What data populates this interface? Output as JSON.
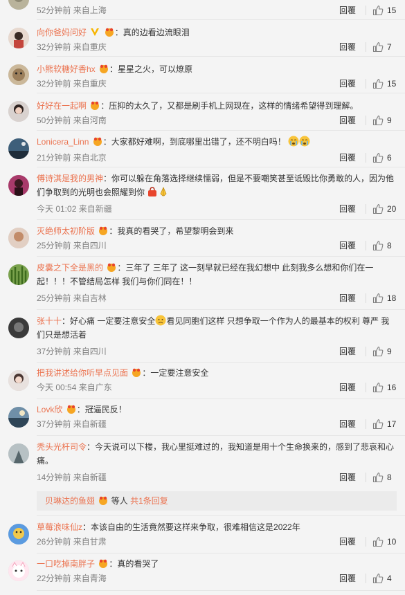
{
  "colors": {
    "username": "#eb7350",
    "meta": "#808080",
    "text": "#333333",
    "background": "#f4f4f4"
  },
  "reply_label": "回覆",
  "comments": [
    {
      "avatar": "avatar",
      "time": "52分钟前",
      "location": "来自上海",
      "likes": "15"
    },
    {
      "avatar": "avatar",
      "user": "向你爸妈问好",
      "text": "：真的边看边流眼泪",
      "time": "32分钟前",
      "location": "来自重庆",
      "likes": "7"
    },
    {
      "avatar": "avatar",
      "user": "小熊软糖好香hx",
      "text": "：星星之火，可以燎原",
      "time": "32分钟前",
      "location": "来自重庆",
      "likes": "15"
    },
    {
      "avatar": "avatar",
      "user": "好好在一起啊",
      "text": "：压抑的太久了，又都是刷手机上网现在，这样的情绪希望得到理解。",
      "time": "50分钟前",
      "location": "来自河南",
      "likes": "9"
    },
    {
      "avatar": "avatar",
      "user": "Lonicera_Linn",
      "text": "：大家都好难啊，到底哪里出错了，还不明白吗！",
      "time": "21分钟前",
      "location": "来自北京",
      "likes": "6"
    },
    {
      "avatar": "avatar",
      "user": "傅诗淇是我的男神",
      "text_line1": "：你可以躲在角落选择继续懦弱，但是不要嘲笑甚至诋毁比你勇敢的人，因为他",
      "text_line2": "们争取到的光明也会照耀到你",
      "time": "今天 01:02",
      "location": "来自新疆",
      "likes": "20"
    },
    {
      "avatar": "avatar",
      "user": "灭绝师太初阶版",
      "text": "：我真的看哭了，希望黎明会到来",
      "time": "25分钟前",
      "location": "来自四川",
      "likes": "8"
    },
    {
      "avatar": "avatar",
      "user": "皮囊之下全是黑的",
      "text_line1": "：三年了 三年了 这一刻早就已经在我幻想中 此刻我多么想和你们在一",
      "text_line2": "起！！！不管结局怎样 我们与你们同在！！",
      "time": "25分钟前",
      "location": "来自吉林",
      "likes": "18"
    },
    {
      "avatar": "avatar",
      "user": "张十十",
      "text_line1": "：好心痛 一定要注意安全",
      "text_line1b": "看见同胞们这样 只想争取一个作为人的最基本的权利 尊严 我",
      "text_line2": "们只是想活着",
      "time": "37分钟前",
      "location": "来自四川",
      "likes": "9"
    },
    {
      "avatar": "avatar",
      "user": "把我讲述给你听早点见面",
      "text": "：一定要注意安全",
      "time": "今天 00:54",
      "location": "来自广东",
      "likes": "16"
    },
    {
      "avatar": "avatar",
      "user": "Lovk欣",
      "text": "：冠逼民反！",
      "time": "37分钟前",
      "location": "来自新疆",
      "likes": "17"
    },
    {
      "avatar": "avatar",
      "user": "秃头光杆司令",
      "text_line1": "：今天说可以下楼，我心里挺难过的，我知道是用十个生命换来的，感到了悲哀和心",
      "text_line2": "痛。",
      "time": "14分钟前",
      "location": "来自新疆",
      "likes": "8"
    },
    {
      "avatar": "avatar",
      "user": "草莓浪味仙z",
      "text": "：本该自由的生活竟然要这样来争取，很难相信这是2022年",
      "time": "26分钟前",
      "location": "来自甘肃",
      "likes": "10"
    },
    {
      "avatar": "avatar",
      "user": "一口吃掉南胖子",
      "text": "：真的看哭了",
      "time": "22分钟前",
      "location": "来自青海",
      "likes": "4"
    }
  ],
  "subreplies": {
    "user": "贝琳达的鱼翅",
    "middle": "等人",
    "count": "共1条回复"
  }
}
